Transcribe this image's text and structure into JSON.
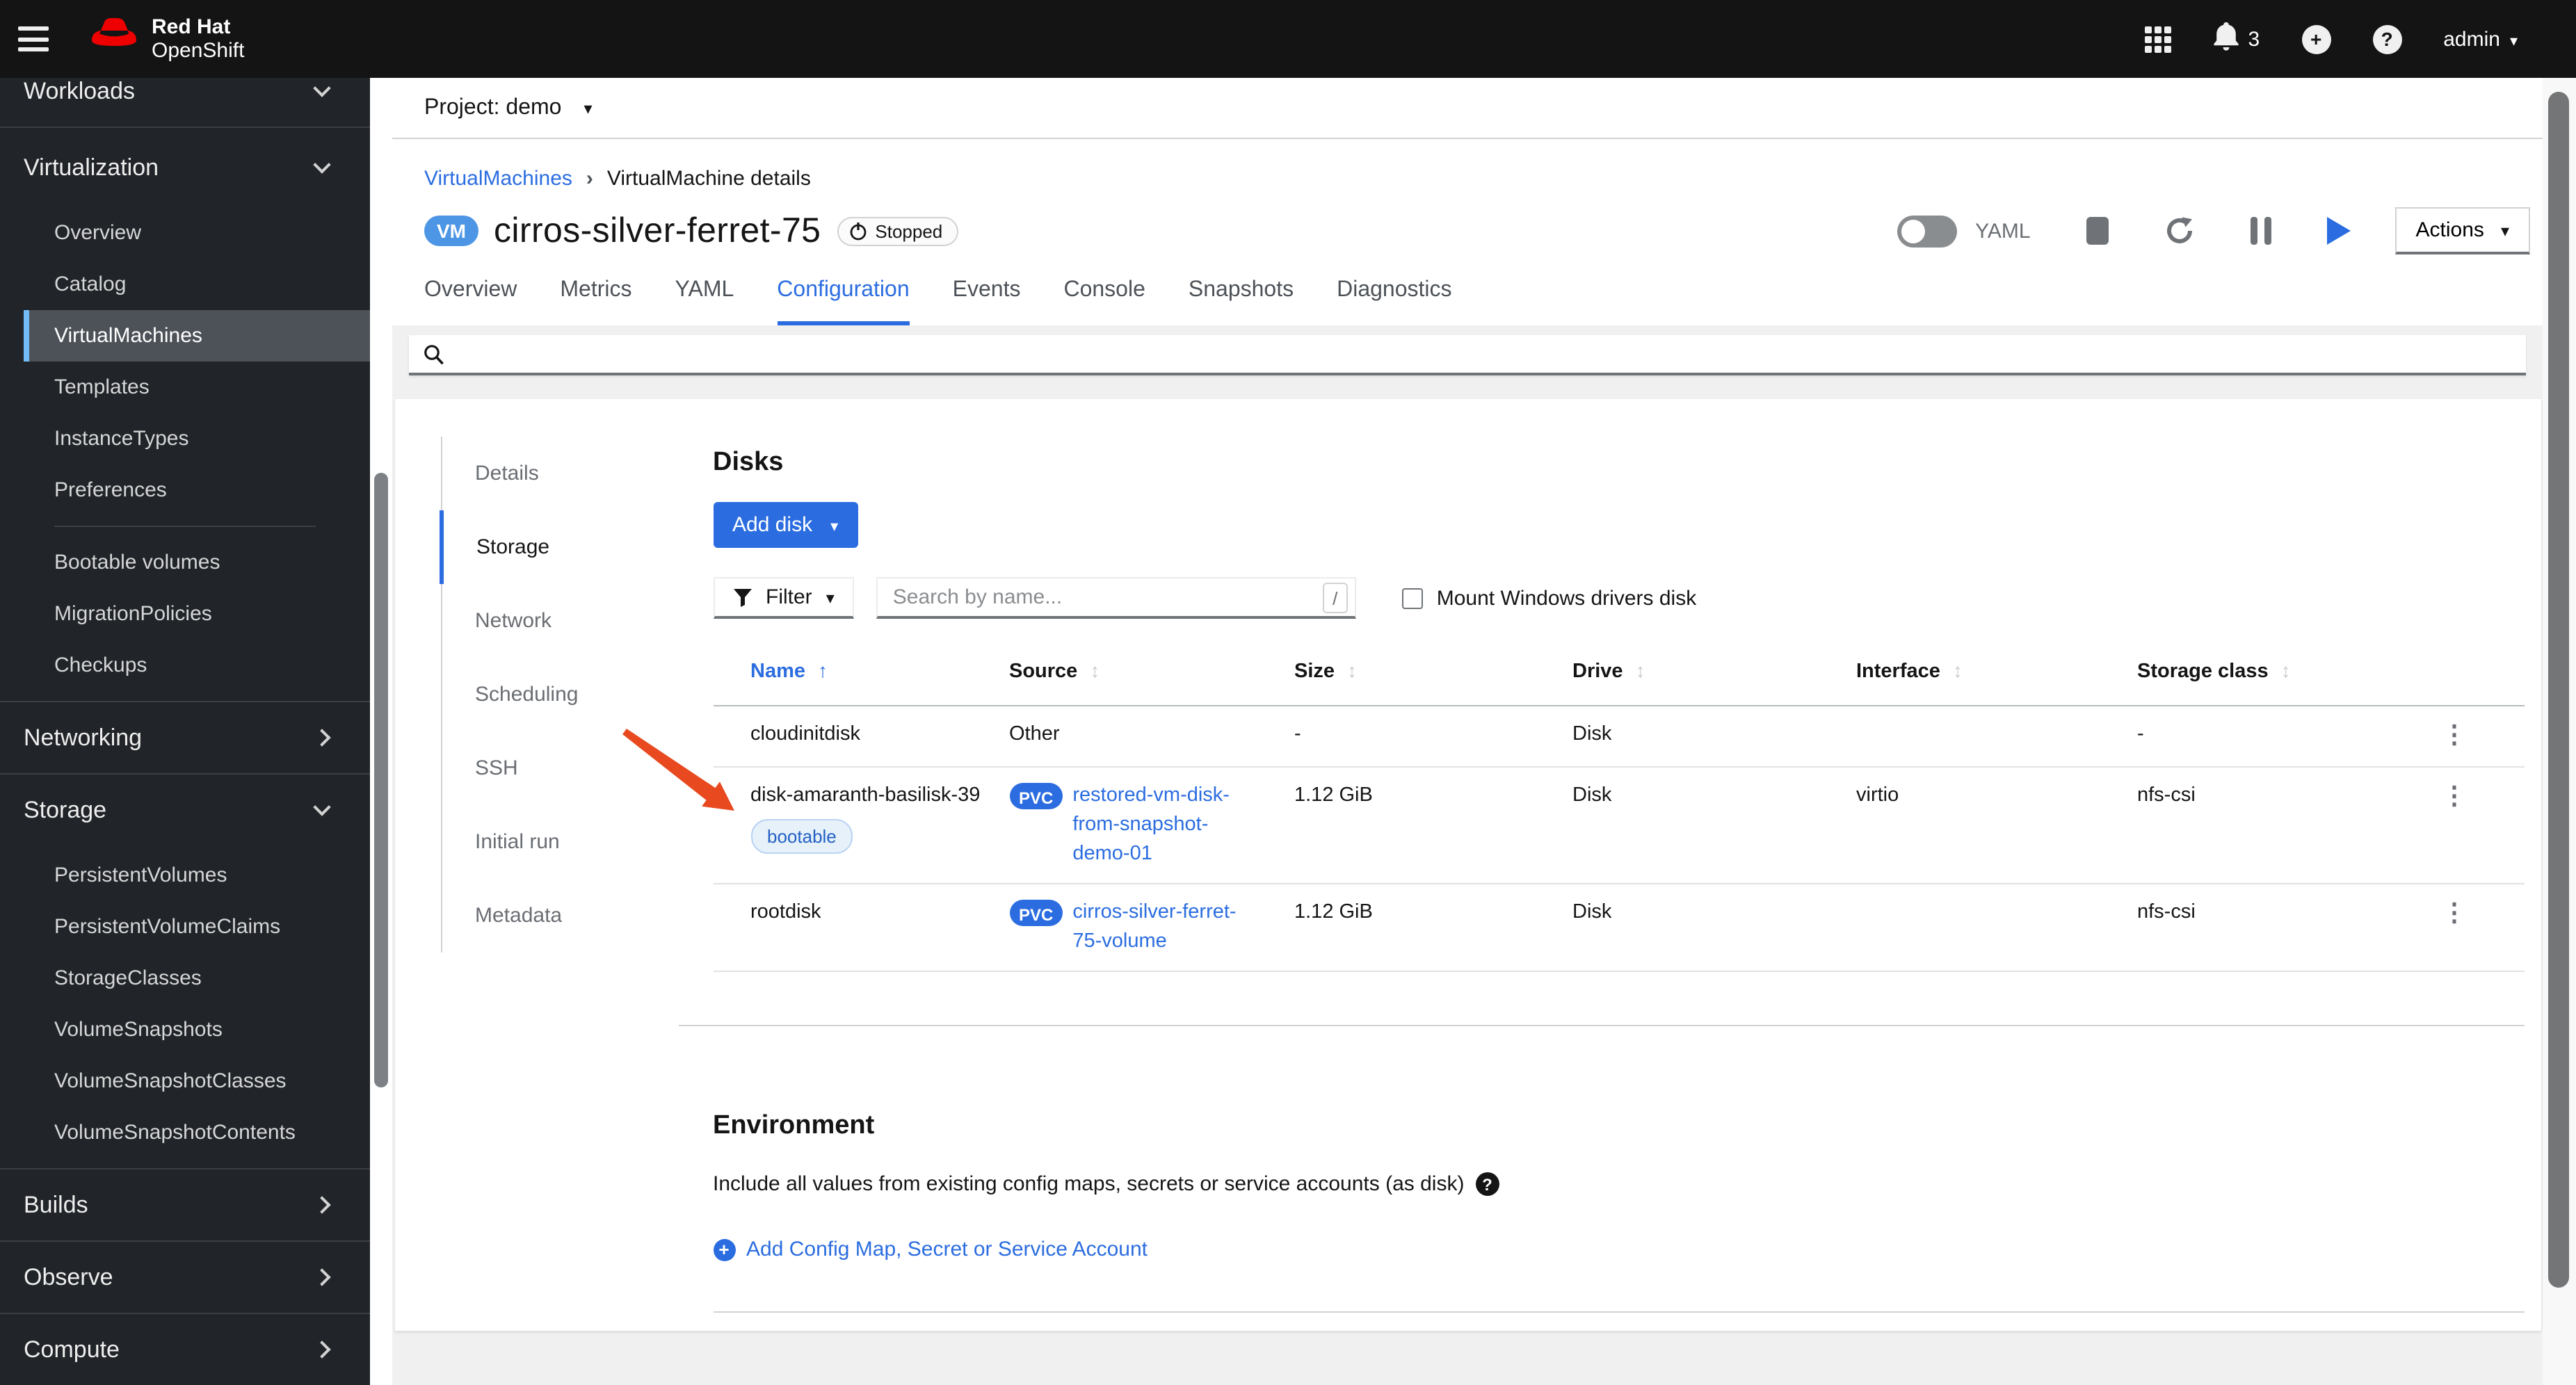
{
  "masthead": {
    "brand_line1": "Red Hat",
    "brand_line2": "OpenShift",
    "notification_count": "3",
    "username": "admin"
  },
  "project_bar": {
    "label": "Project:",
    "value": "demo"
  },
  "sidebar": {
    "workloads": "Workloads",
    "virtualization": {
      "label": "Virtualization",
      "children": [
        "Overview",
        "Catalog",
        "VirtualMachines",
        "Templates",
        "InstanceTypes",
        "Preferences"
      ],
      "children2": [
        "Bootable volumes",
        "MigrationPolicies",
        "Checkups"
      ],
      "selected": "VirtualMachines"
    },
    "networking": "Networking",
    "storage": {
      "label": "Storage",
      "children": [
        "PersistentVolumes",
        "PersistentVolumeClaims",
        "StorageClasses",
        "VolumeSnapshots",
        "VolumeSnapshotClasses",
        "VolumeSnapshotContents"
      ]
    },
    "builds": "Builds",
    "observe": "Observe",
    "compute": "Compute"
  },
  "page": {
    "breadcrumb": [
      "VirtualMachines",
      "VirtualMachine details"
    ],
    "vm_badge": "VM",
    "title": "cirros-silver-ferret-75",
    "status": "Stopped",
    "yaml_toggle_label": "YAML",
    "actions_label": "Actions",
    "tabs": [
      "Overview",
      "Metrics",
      "YAML",
      "Configuration",
      "Events",
      "Console",
      "Snapshots",
      "Diagnostics"
    ],
    "active_tab": "Configuration"
  },
  "subnav": {
    "items": [
      "Details",
      "Storage",
      "Network",
      "Scheduling",
      "SSH",
      "Initial run",
      "Metadata"
    ],
    "active": "Storage"
  },
  "disks": {
    "heading": "Disks",
    "add_button": "Add disk",
    "filter_label": "Filter",
    "search_placeholder": "Search by name...",
    "search_shortcut": "/",
    "checkbox_label": "Mount Windows drivers disk",
    "columns": [
      "Name",
      "Source",
      "Size",
      "Drive",
      "Interface",
      "Storage class"
    ],
    "sorted_column": "Name",
    "rows": [
      {
        "name": "cloudinitdisk",
        "badge": "",
        "source_badge": "",
        "source": "Other",
        "size": "-",
        "drive": "Disk",
        "interface": "",
        "storage_class": "-"
      },
      {
        "name": "disk-amaranth-basilisk-39",
        "badge": "bootable",
        "source_badge": "PVC",
        "source": "restored-vm-disk-from-snapshot-demo-01",
        "size": "1.12 GiB",
        "drive": "Disk",
        "interface": "virtio",
        "storage_class": "nfs-csi"
      },
      {
        "name": "rootdisk",
        "badge": "",
        "source_badge": "PVC",
        "source": "cirros-silver-ferret-75-volume",
        "size": "1.12 GiB",
        "drive": "Disk",
        "interface": "",
        "storage_class": "nfs-csi"
      }
    ]
  },
  "environment": {
    "heading": "Environment",
    "description": "Include all values from existing config maps, secrets or service accounts (as disk)",
    "add_link": "Add Config Map, Secret or Service Account"
  },
  "colors": {
    "accent": "#2b6de0",
    "masthead_bg": "#141414",
    "sidebar_bg": "#212428",
    "selected_nav_bg": "#4d5258",
    "selected_nav_border": "#73bcf7",
    "annotation_arrow": "#e8491f",
    "status_badge_border": "#d2d2d2"
  }
}
